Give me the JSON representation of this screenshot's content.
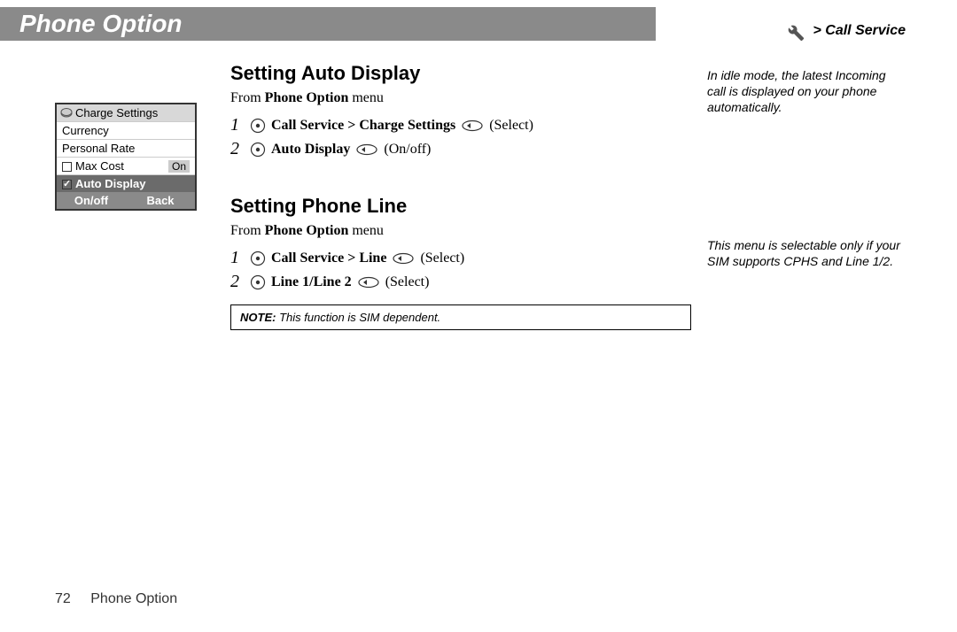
{
  "header": {
    "title": "Phone Option"
  },
  "breadcrumb": {
    "label": "> Call Service"
  },
  "screenshot": {
    "header": "Charge Settings",
    "rows": {
      "currency": "Currency",
      "personal_rate": "Personal Rate",
      "max_cost": "Max Cost",
      "max_cost_value": "On",
      "auto_display": "Auto Display"
    },
    "footer": {
      "left": "On/off",
      "right": "Back"
    }
  },
  "section1": {
    "title": "Setting Auto Display",
    "from_pre": "From ",
    "from_bold": "Phone Option",
    "from_post": " menu",
    "step1": {
      "num": "1",
      "bold": "Call Service > Charge Settings",
      "action": "(Select)"
    },
    "step2": {
      "num": "2",
      "bold": "Auto Display",
      "action": "(On/off)"
    }
  },
  "section2": {
    "title": "Setting Phone Line",
    "from_pre": "From ",
    "from_bold": "Phone Option",
    "from_post": " menu",
    "step1": {
      "num": "1",
      "bold": "Call Service > Line",
      "action": "(Select)"
    },
    "step2": {
      "num": "2",
      "bold": "Line 1/Line 2",
      "action": "(Select)"
    },
    "note_label": "NOTE:",
    "note_text": " This function is SIM dependent."
  },
  "sidenote1": "In idle mode, the latest Incoming call is displayed on your phone automatically.",
  "sidenote2": "This menu is selectable only if your SIM supports CPHS and Line 1/2.",
  "footer": {
    "page": "72",
    "label": "Phone Option"
  }
}
